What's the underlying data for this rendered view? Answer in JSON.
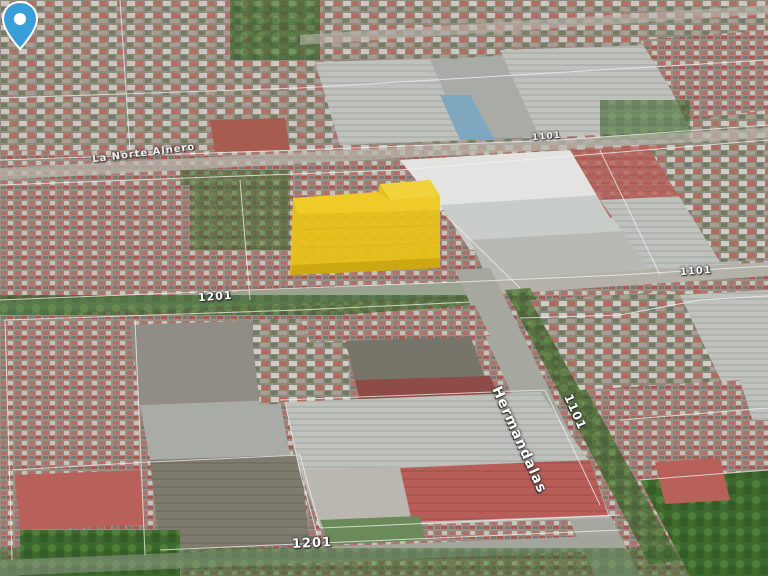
{
  "map": {
    "view": "3d-satellite-aerial",
    "highlight_color": "#e8c21a",
    "pin_color": "#3a9fd8",
    "street_labels": {
      "street_top_left": "La Norte Alnero",
      "street_top_right": "1101",
      "street_mid_left": "1201",
      "street_mid_right": "1101",
      "street_diag_name": "Hermandalas",
      "street_diag_num": "1101",
      "street_bottom": "1201"
    },
    "icons": {
      "pin": "location-pin-icon"
    }
  }
}
